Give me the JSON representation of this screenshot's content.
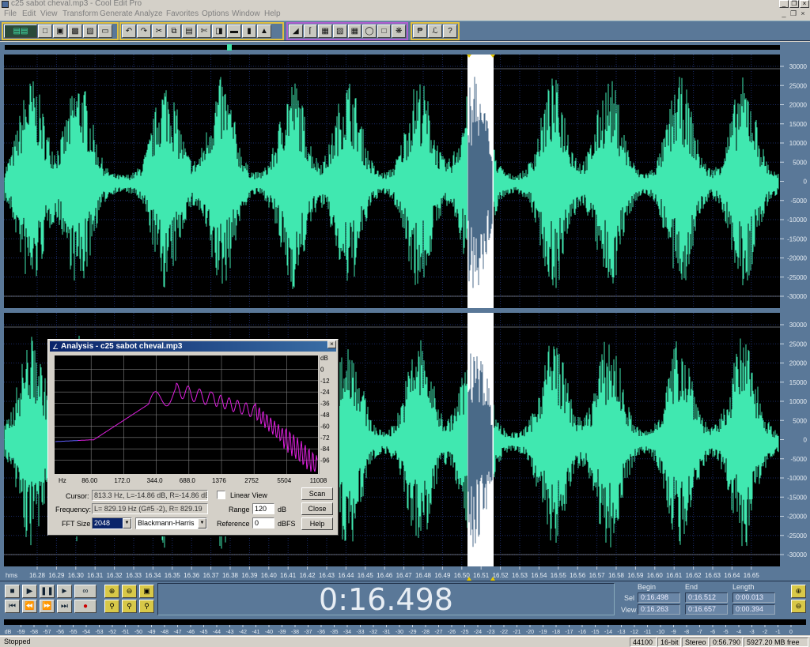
{
  "window": {
    "title": "c25 sabot cheval.mp3 - Cool Edit Pro",
    "minimize": "_",
    "restore": "❐",
    "close": "×"
  },
  "menu": [
    {
      "label": "File",
      "id": "file"
    },
    {
      "label": "Edit",
      "id": "edit"
    },
    {
      "label": "View",
      "id": "view"
    },
    {
      "label": "Transform",
      "id": "transform"
    },
    {
      "label": "Generate",
      "id": "generate"
    },
    {
      "label": "Analyze",
      "id": "analyze"
    },
    {
      "label": "Favorites",
      "id": "favorites"
    },
    {
      "label": "Options",
      "id": "options"
    },
    {
      "label": "Window",
      "id": "window"
    },
    {
      "label": "Help",
      "id": "help"
    }
  ],
  "waveform": {
    "amplitude_ticks": [
      "30000",
      "25000",
      "20000",
      "15000",
      "10000",
      "5000",
      "0",
      "-5000",
      "-10000",
      "-15000",
      "-20000",
      "-25000",
      "-30000"
    ],
    "time_unit": "hms",
    "time_ticks": [
      "16.28",
      "16.29",
      "16.30",
      "16.31",
      "16.32",
      "16.33",
      "16.34",
      "16.35",
      "16.36",
      "16.37",
      "16.38",
      "16.39",
      "16.40",
      "16.41",
      "16.42",
      "16.43",
      "16.44",
      "16.45",
      "16.46",
      "16.47",
      "16.48",
      "16.49",
      "16.50",
      "16.51",
      "16.52",
      "16.53",
      "16.54",
      "16.55",
      "16.56",
      "16.57",
      "16.58",
      "16.59",
      "16.60",
      "16.61",
      "16.62",
      "16.63",
      "16.64",
      "16.65"
    ],
    "wave_color": "#40e8b0",
    "selection_color": "#ffffff"
  },
  "analysis": {
    "title": "Analysis - c25 sabot cheval.mp3",
    "close": "×",
    "db_ticks": [
      "dB",
      "0",
      "-12",
      "-24",
      "-36",
      "-48",
      "-60",
      "-72",
      "-84",
      "-96"
    ],
    "freq_ticks": [
      "Hz",
      "86.00",
      "172.0",
      "344.0",
      "688.0",
      "1376",
      "2752",
      "5504",
      "11008"
    ],
    "cursor_label": "Cursor:",
    "cursor_value": "813.3 Hz, L=-14.86 dB, R=-14.86 dB",
    "frequency_label": "Frequency:",
    "frequency_value": "L= 829.19 Hz (G#5 -2), R= 829.19",
    "fft_label": "FFT Size",
    "fft_value": "2048",
    "window_value": "Blackmann-Harris",
    "linear_view": "Linear View",
    "range_label": "Range",
    "range_value": "120",
    "range_unit": "dB",
    "reference_label": "Reference",
    "reference_value": "0",
    "reference_unit": "dBFS",
    "scan": "Scan",
    "close_btn": "Close",
    "help": "Help"
  },
  "time_display": "0:16.498",
  "selection": {
    "begin_label": "Begin",
    "end_label": "End",
    "length_label": "Length",
    "sel_label": "Sel",
    "view_label": "View",
    "sel_begin": "0:16.498",
    "sel_end": "0:16.512",
    "sel_length": "0:00.013",
    "view_begin": "0:16.263",
    "view_end": "0:16.657",
    "view_length": "0:00.394"
  },
  "meter_ticks": [
    "dB",
    "-59",
    "-58",
    "-57",
    "-56",
    "-55",
    "-54",
    "-53",
    "-52",
    "-51",
    "-50",
    "-49",
    "-48",
    "-47",
    "-46",
    "-45",
    "-44",
    "-43",
    "-42",
    "-41",
    "-40",
    "-39",
    "-38",
    "-37",
    "-36",
    "-35",
    "-34",
    "-33",
    "-32",
    "-31",
    "-30",
    "-29",
    "-28",
    "-27",
    "-26",
    "-25",
    "-24",
    "-23",
    "-22",
    "-21",
    "-20",
    "-19",
    "-18",
    "-17",
    "-16",
    "-15",
    "-14",
    "-13",
    "-12",
    "-11",
    "-10",
    "-9",
    "-8",
    "-7",
    "-6",
    "-5",
    "-4",
    "-3",
    "-2",
    "-1",
    "0"
  ],
  "status": {
    "state": "Stopped",
    "rate": "44100",
    "bits": "16-bit",
    "channels": "Stereo",
    "duration": "0:56.790",
    "free": "5927.20 MB free"
  }
}
